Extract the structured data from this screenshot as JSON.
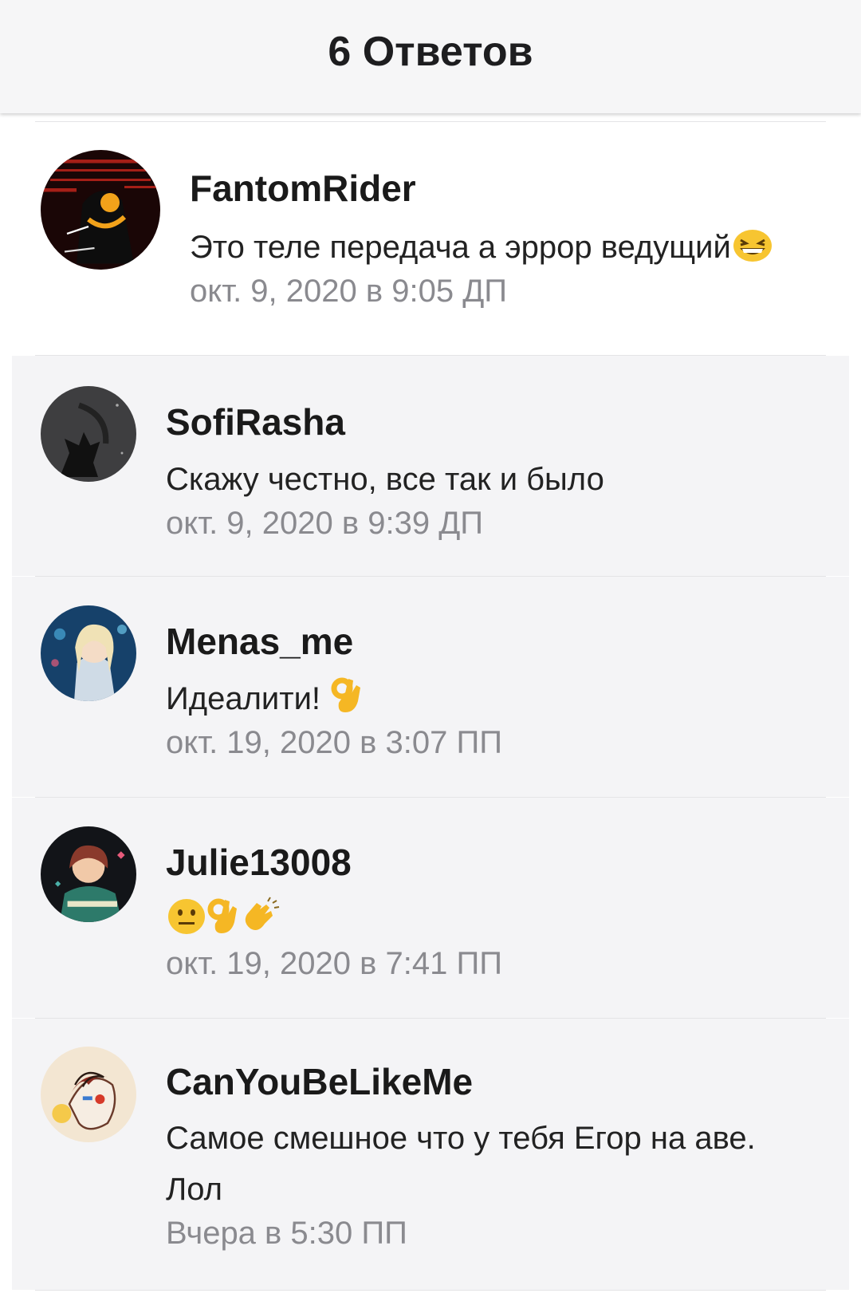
{
  "header": {
    "title": "6 Ответов"
  },
  "replies": [
    {
      "username": "FantomRider",
      "text": "Это теле передача а эррор ведущий",
      "emojis": [
        "grinning-squinting-face-emoji"
      ],
      "time": "окт. 9, 2020 в 9:05 ДП",
      "avatar": "avatar-error-character"
    },
    {
      "username": "SofiRasha",
      "text": "Скажу честно, все так и было",
      "emojis": [],
      "time": "окт. 9, 2020 в 9:39 ДП",
      "avatar": "avatar-dark-wolf"
    },
    {
      "username": "Menas_me",
      "text": "Идеалити!",
      "emojis": [
        "ok-hand-emoji"
      ],
      "time": "окт. 19, 2020 в 3:07 ПП",
      "avatar": "avatar-anime-girl"
    },
    {
      "username": "Julie13008",
      "text": "",
      "emojis": [
        "neutral-face-emoji",
        "ok-hand-emoji",
        "clapping-hands-emoji"
      ],
      "time": "окт. 19, 2020 в 7:41 ПП",
      "avatar": "avatar-anime-boy"
    },
    {
      "username": "CanYouBeLikeMe",
      "text": "Самое смешное что у тебя Егор на аве.",
      "text_line2": "Лол",
      "emojis": [],
      "time": "Вчера в 5:30 ПП",
      "avatar": "avatar-sketch"
    }
  ]
}
